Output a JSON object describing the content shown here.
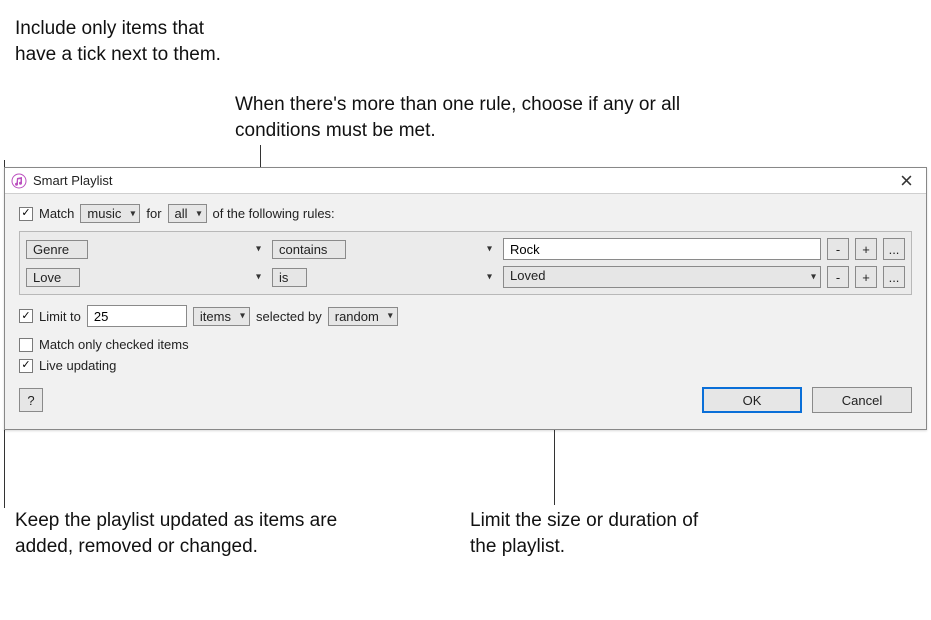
{
  "callouts": {
    "top_left": "Include only items that have a tick next to them.",
    "top_right": "When there's more than one rule, choose if any or all conditions must be met.",
    "bottom_left": "Keep the playlist updated as items are added, removed or changed.",
    "bottom_right": "Limit the size or duration of the playlist."
  },
  "window": {
    "title": "Smart Playlist"
  },
  "match": {
    "checkbox_label": "Match",
    "media_type": "music",
    "for_label": "for",
    "scope": "all",
    "suffix": "of the following rules:"
  },
  "rules": [
    {
      "field": "Genre",
      "operator": "contains",
      "value": "Rock",
      "value_is_select": false
    },
    {
      "field": "Love",
      "operator": "is",
      "value": "Loved",
      "value_is_select": true
    }
  ],
  "limit": {
    "checkbox_label": "Limit to",
    "count": "25",
    "unit": "items",
    "selected_by_label": "selected by",
    "method": "random"
  },
  "options": {
    "match_checked": "Match only checked items",
    "live_updating": "Live updating"
  },
  "buttons": {
    "help": "?",
    "ok": "OK",
    "cancel": "Cancel",
    "minus": "-",
    "plus": "+",
    "more": "..."
  }
}
